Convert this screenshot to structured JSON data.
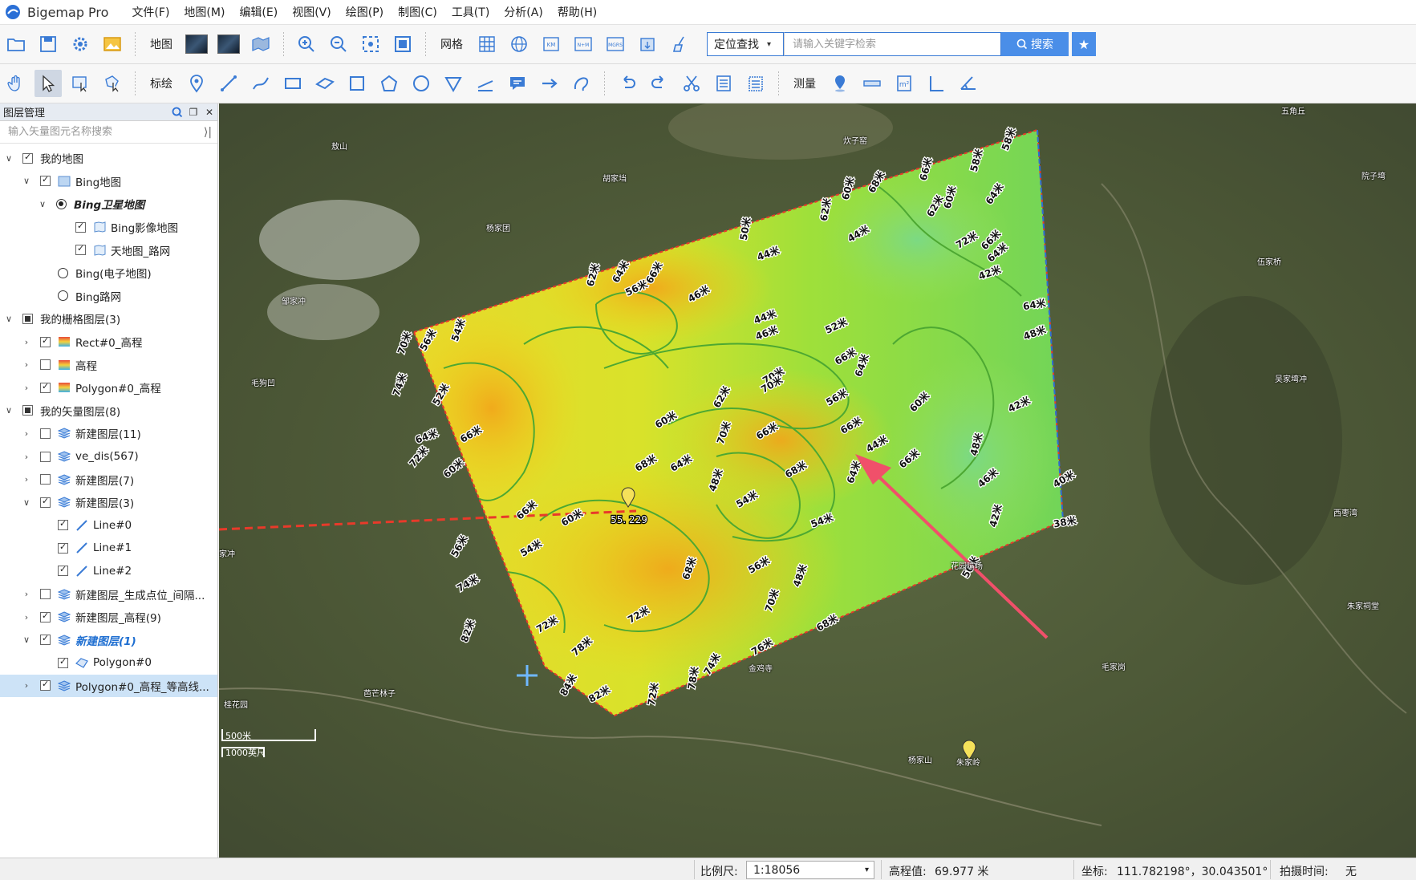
{
  "app": {
    "title": "Bigemap Pro"
  },
  "menu": [
    "文件(F)",
    "地图(M)",
    "编辑(E)",
    "视图(V)",
    "绘图(P)",
    "制图(C)",
    "工具(T)",
    "分析(A)",
    "帮助(H)"
  ],
  "toolbar1": {
    "map_label": "地图",
    "grid_label": "网格",
    "search_mode": "定位查找",
    "search_placeholder": "请输入关键字检索",
    "search_button": "搜索"
  },
  "toolbar2": {
    "draw_label": "标绘",
    "measure_label": "测量"
  },
  "layer_panel": {
    "title": "图层管理",
    "search_placeholder": "输入矢量图元名称搜索",
    "items": [
      {
        "label": "我的地图"
      },
      {
        "label": "Bing地图"
      },
      {
        "label": "Bing卫星地图"
      },
      {
        "label": "Bing影像地图"
      },
      {
        "label": "天地图_路网"
      },
      {
        "label": "Bing(电子地图)"
      },
      {
        "label": "Bing路网"
      },
      {
        "label": "我的栅格图层(3)"
      },
      {
        "label": "Rect#0_高程"
      },
      {
        "label": "高程"
      },
      {
        "label": "Polygon#0_高程"
      },
      {
        "label": "我的矢量图层(8)"
      },
      {
        "label": "新建图层(11)"
      },
      {
        "label": "ve_dis(567)"
      },
      {
        "label": "新建图层(7)"
      },
      {
        "label": "新建图层(3)"
      },
      {
        "label": "Line#0"
      },
      {
        "label": "Line#1"
      },
      {
        "label": "Line#2"
      },
      {
        "label": "新建图层_生成点位_间隔..."
      },
      {
        "label": "新建图层_高程(9)"
      },
      {
        "label": "新建图层(1)"
      },
      {
        "label": "Polygon#0"
      },
      {
        "label": "Polygon#0_高程_等高线..."
      }
    ]
  },
  "map": {
    "point_label": "55. 229",
    "scale_bar": [
      "500米",
      "1000英尺"
    ],
    "places": [
      "五角丘",
      "炊子窑",
      "敖山",
      "胡家垱",
      "杨家团",
      "邹家冲",
      "毛狗凹",
      "伍家桥",
      "吴家塆冲",
      "西枣湾",
      "朱家祠堂",
      "毛家岗",
      "杨家山",
      "朱家岭",
      "芭芒林子",
      "桂花园",
      "金鸡寺",
      "花园嘴场",
      "院子塆",
      "家冲"
    ],
    "contours": [
      "58米",
      "60米",
      "62米",
      "64米",
      "66米",
      "58米",
      "68米",
      "60米",
      "44米",
      "62米",
      "50米",
      "44米",
      "66米",
      "72米",
      "64米",
      "62米",
      "64米",
      "66米",
      "56米",
      "46米",
      "44米",
      "42米",
      "64米",
      "48米",
      "70米",
      "56米",
      "54米",
      "46米",
      "52米",
      "66米",
      "64米",
      "74米",
      "52米",
      "70米",
      "62米",
      "60米",
      "42米",
      "48米",
      "70米",
      "70米",
      "56米",
      "66米",
      "60米",
      "64米",
      "72米",
      "66米",
      "68米",
      "64米",
      "66米",
      "44米",
      "40米",
      "60米",
      "68米",
      "64米",
      "66米",
      "48米",
      "54米",
      "38米",
      "54米",
      "60米",
      "66米",
      "56米",
      "54米",
      "42米",
      "46米",
      "50米",
      "74米",
      "72米",
      "68米",
      "56米",
      "48米",
      "82米",
      "72米",
      "70米",
      "68米",
      "78米",
      "76米",
      "74米",
      "84米",
      "82米",
      "72米",
      "78米"
    ]
  },
  "status": {
    "scale_label": "比例尺:",
    "scale_value": "1:18056",
    "elevation_label": "高程值:",
    "elevation_value": "69.977 米",
    "coord_label": "坐标:",
    "coord_value": "111.782198°，30.043501°",
    "capture_label": "拍摄时间:",
    "capture_value": "无"
  }
}
